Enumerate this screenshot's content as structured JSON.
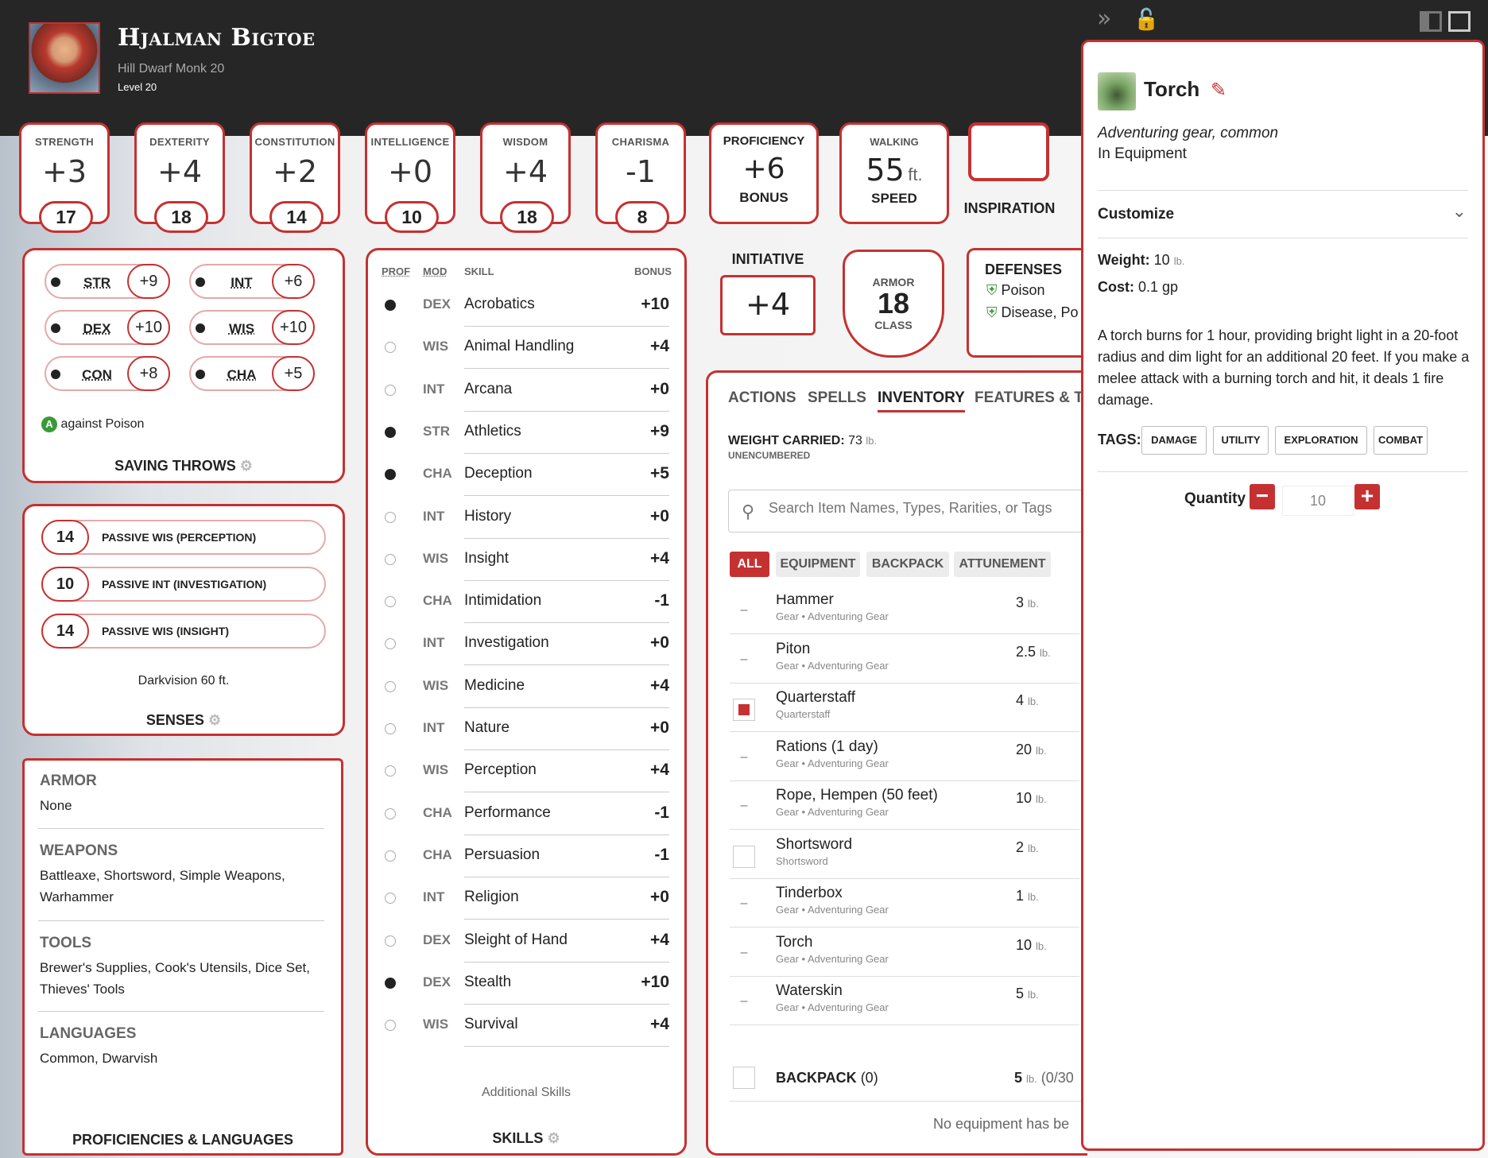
{
  "header": {
    "name": "Hjalman Bigtoe",
    "subtitle": "Hill Dwarf  Monk 20",
    "level": "Level 20"
  },
  "abilities": [
    {
      "label": "STRENGTH",
      "mod": "+3",
      "score": "17"
    },
    {
      "label": "DEXTERITY",
      "mod": "+4",
      "score": "18"
    },
    {
      "label": "CONSTITUTION",
      "mod": "+2",
      "score": "14"
    },
    {
      "label": "INTELLIGENCE",
      "mod": "+0",
      "score": "10"
    },
    {
      "label": "WISDOM",
      "mod": "+4",
      "score": "18"
    },
    {
      "label": "CHARISMA",
      "mod": "-1",
      "score": "8"
    }
  ],
  "proficiency": {
    "label": "PROFICIENCY",
    "value": "+6",
    "sub": "BONUS"
  },
  "speed": {
    "label": "WALKING",
    "value": "55",
    "unit": "ft.",
    "sub": "SPEED"
  },
  "inspiration": {
    "label": "INSPIRATION"
  },
  "initiative": {
    "label": "INITIATIVE",
    "value": "+4"
  },
  "armor": {
    "top": "ARMOR",
    "value": "18",
    "bottom": "CLASS"
  },
  "defenses": {
    "title": "DEFENSES",
    "items": [
      "Poison",
      "Disease, Po"
    ]
  },
  "saving_throws": {
    "title": "SAVING THROWS",
    "note": "against Poison",
    "items": [
      {
        "ab": "STR",
        "bonus": "+9"
      },
      {
        "ab": "INT",
        "bonus": "+6"
      },
      {
        "ab": "DEX",
        "bonus": "+10"
      },
      {
        "ab": "WIS",
        "bonus": "+10"
      },
      {
        "ab": "CON",
        "bonus": "+8"
      },
      {
        "ab": "CHA",
        "bonus": "+5"
      }
    ]
  },
  "senses": {
    "title": "SENSES",
    "note": "Darkvision 60 ft.",
    "passives": [
      {
        "value": "14",
        "label": "PASSIVE WIS (PERCEPTION)"
      },
      {
        "value": "10",
        "label": "PASSIVE INT (INVESTIGATION)"
      },
      {
        "value": "14",
        "label": "PASSIVE WIS (INSIGHT)"
      }
    ]
  },
  "proficiencies": {
    "title": "PROFICIENCIES & LANGUAGES",
    "groups": [
      {
        "head": "ARMOR",
        "value": "None"
      },
      {
        "head": "WEAPONS",
        "value": "Battleaxe, Shortsword, Simple Weapons, Warhammer"
      },
      {
        "head": "TOOLS",
        "value": "Brewer's Supplies, Cook's Utensils, Dice Set, Thieves' Tools"
      },
      {
        "head": "LANGUAGES",
        "value": "Common, Dwarvish"
      }
    ]
  },
  "skills": {
    "title": "SKILLS",
    "additional": "Additional Skills",
    "headers": {
      "prof": "PROF",
      "mod": "MOD",
      "skill": "SKILL",
      "bonus": "BONUS"
    },
    "items": [
      {
        "prof": true,
        "mod": "DEX",
        "name": "Acrobatics",
        "bonus": "+10"
      },
      {
        "prof": false,
        "mod": "WIS",
        "name": "Animal Handling",
        "bonus": "+4"
      },
      {
        "prof": false,
        "mod": "INT",
        "name": "Arcana",
        "bonus": "+0"
      },
      {
        "prof": true,
        "mod": "STR",
        "name": "Athletics",
        "bonus": "+9"
      },
      {
        "prof": true,
        "mod": "CHA",
        "name": "Deception",
        "bonus": "+5"
      },
      {
        "prof": false,
        "mod": "INT",
        "name": "History",
        "bonus": "+0"
      },
      {
        "prof": false,
        "mod": "WIS",
        "name": "Insight",
        "bonus": "+4"
      },
      {
        "prof": false,
        "mod": "CHA",
        "name": "Intimidation",
        "bonus": "-1"
      },
      {
        "prof": false,
        "mod": "INT",
        "name": "Investigation",
        "bonus": "+0"
      },
      {
        "prof": false,
        "mod": "WIS",
        "name": "Medicine",
        "bonus": "+4"
      },
      {
        "prof": false,
        "mod": "INT",
        "name": "Nature",
        "bonus": "+0"
      },
      {
        "prof": false,
        "mod": "WIS",
        "name": "Perception",
        "bonus": "+4"
      },
      {
        "prof": false,
        "mod": "CHA",
        "name": "Performance",
        "bonus": "-1"
      },
      {
        "prof": false,
        "mod": "CHA",
        "name": "Persuasion",
        "bonus": "-1"
      },
      {
        "prof": false,
        "mod": "INT",
        "name": "Religion",
        "bonus": "+0"
      },
      {
        "prof": false,
        "mod": "DEX",
        "name": "Sleight of Hand",
        "bonus": "+4"
      },
      {
        "prof": true,
        "mod": "DEX",
        "name": "Stealth",
        "bonus": "+10"
      },
      {
        "prof": false,
        "mod": "WIS",
        "name": "Survival",
        "bonus": "+4"
      }
    ]
  },
  "tabs": [
    "ACTIONS",
    "SPELLS",
    "INVENTORY",
    "FEATURES & TR"
  ],
  "inventory": {
    "weight_label": "WEIGHT CARRIED:",
    "weight_value": "73",
    "weight_unit": "lb.",
    "encumbrance": "UNENCUMBERED",
    "search_placeholder": "Search Item Names, Types, Rarities, or Tags",
    "filters": [
      "ALL",
      "EQUIPMENT",
      "BACKPACK",
      "ATTUNEMENT"
    ],
    "items": [
      {
        "name": "Hammer",
        "sub": "Gear • Adventuring Gear",
        "weight": "3",
        "unit": "lb.",
        "check": "dash"
      },
      {
        "name": "Piton",
        "sub": "Gear • Adventuring Gear",
        "weight": "2.5",
        "unit": "lb.",
        "check": "dash"
      },
      {
        "name": "Quarterstaff",
        "sub": "Quarterstaff",
        "weight": "4",
        "unit": "lb.",
        "check": "on"
      },
      {
        "name": "Rations (1 day)",
        "sub": "Gear • Adventuring Gear",
        "weight": "20",
        "unit": "lb.",
        "check": "dash"
      },
      {
        "name": "Rope, Hempen (50 feet)",
        "sub": "Gear • Adventuring Gear",
        "weight": "10",
        "unit": "lb.",
        "check": "dash"
      },
      {
        "name": "Shortsword",
        "sub": "Shortsword",
        "weight": "2",
        "unit": "lb.",
        "check": "off"
      },
      {
        "name": "Tinderbox",
        "sub": "Gear • Adventuring Gear",
        "weight": "1",
        "unit": "lb.",
        "check": "dash"
      },
      {
        "name": "Torch",
        "sub": "Gear • Adventuring Gear",
        "weight": "10",
        "unit": "lb.",
        "check": "dash"
      },
      {
        "name": "Waterskin",
        "sub": "Gear • Adventuring Gear",
        "weight": "5",
        "unit": "lb.",
        "check": "dash"
      }
    ],
    "backpack_label": "BACKPACK",
    "backpack_count": "(0)",
    "backpack_weight": "5",
    "backpack_unit": "lb.",
    "backpack_cap": "(0/30",
    "empty_note": "No equipment has be"
  },
  "detail": {
    "title": "Torch",
    "type": "Adventuring gear, common",
    "location": "In Equipment",
    "customize": "Customize",
    "weight_label": "Weight:",
    "weight_value": "10",
    "weight_unit": "lb.",
    "cost_label": "Cost:",
    "cost_value": "0.1 gp",
    "description": "A torch burns for 1 hour, providing bright light in a 20-foot radius and dim light for an additional 20 feet. If you make a melee attack with a burning torch and hit, it deals 1 fire damage.",
    "tags_label": "TAGS:",
    "tags": [
      "DAMAGE",
      "UTILITY",
      "EXPLORATION",
      "COMBAT"
    ],
    "quantity_label": "Quantity",
    "quantity": "10"
  },
  "colors": {
    "accent": "#c53131",
    "header": "#262626"
  }
}
